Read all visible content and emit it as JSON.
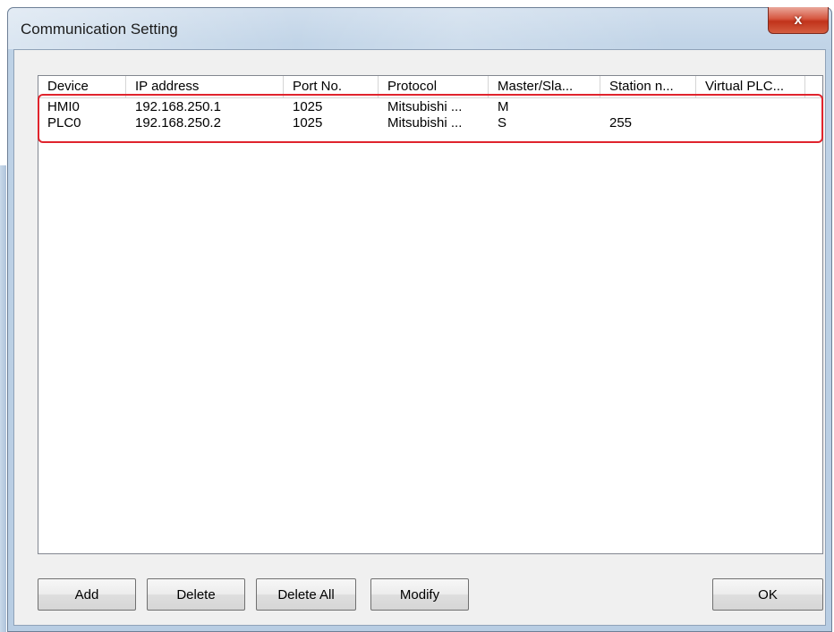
{
  "window": {
    "title": "Communication Setting",
    "close_glyph": "x"
  },
  "table": {
    "columns": [
      "Device",
      "IP address",
      "Port No.",
      "Protocol",
      "Master/Sla...",
      "Station n...",
      "Virtual PLC..."
    ],
    "rows": [
      [
        "HMI0",
        "192.168.250.1",
        "1025",
        "Mitsubishi ...",
        "M",
        "",
        ""
      ],
      [
        "PLC0",
        "192.168.250.2",
        "1025",
        "Mitsubishi ...",
        "S",
        "255",
        ""
      ]
    ]
  },
  "buttons": {
    "add": "Add",
    "delete": "Delete",
    "delete_all": "Delete All",
    "modify": "Modify",
    "ok": "OK"
  },
  "colors": {
    "highlight": "#e0242d",
    "close_button": "#c1331b",
    "window_frame": "#bed2e6"
  }
}
